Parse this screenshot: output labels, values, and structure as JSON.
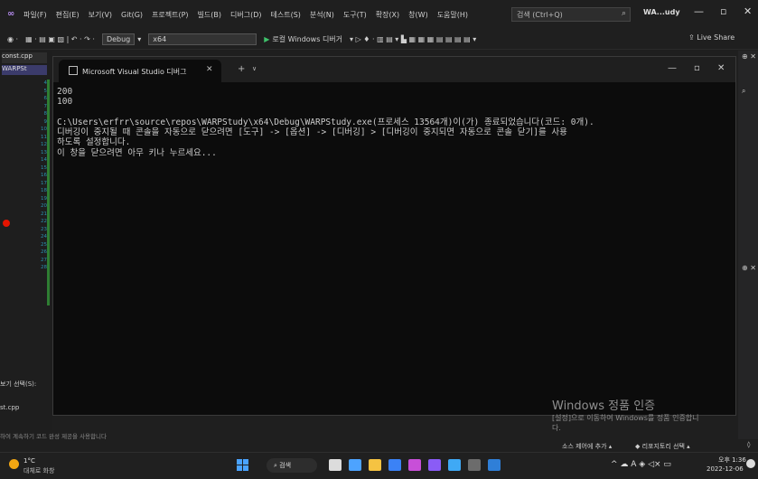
{
  "vs": {
    "menu": [
      "파일(F)",
      "편집(E)",
      "보기(V)",
      "Git(G)",
      "프로젝트(P)",
      "빌드(B)",
      "디버그(D)",
      "테스트(S)",
      "분석(N)",
      "도구(T)",
      "확장(X)",
      "창(W)",
      "도움말(H)"
    ],
    "search_placeholder": "검색 (Ctrl+Q)",
    "solution_name": "WA...udy",
    "toolbar": {
      "config": "Debug",
      "platform": "x64",
      "run_label": "로컬 Windows 디버거",
      "live_share": "Live Share"
    },
    "file_tab": "const.cpp",
    "project_tab": "WARPSt",
    "line_numbers": [
      "4",
      "5",
      "6",
      "7",
      "8",
      "9",
      "10",
      "11",
      "12",
      "13",
      "14",
      "15",
      "16",
      "17",
      "18",
      "19",
      "20",
      "21",
      "22",
      "23",
      "24",
      "25",
      "26",
      "27",
      "28"
    ],
    "bottom_left": [
      "보기 선택(S):",
      "st.cpp",
      "하여 계속하기 코드 완성 제공을 사용합니다"
    ],
    "status_right": [
      "소스 제어에 추가",
      "리포지토리 선택"
    ]
  },
  "console": {
    "tab_title": "Microsoft Visual Studio 디버그",
    "lines": [
      "200",
      "100",
      "",
      "C:\\Users\\erfrr\\source\\repos\\WARPStudy\\x64\\Debug\\WARPStudy.exe(프로세스 13564개)이(가) 종료되었습니다(코드: 0개).",
      "디버깅이 중지될 때 콘솔을 자동으로 닫으려면 [도구] -> [옵션] -> [디버깅] > [디버깅이 중지되면 자동으로 콘솔 닫기]를 사용",
      "하도록 설정합니다.",
      "이 창을 닫으려면 아무 키나 누르세요..."
    ]
  },
  "watermark": {
    "title": "Windows 정품 인증",
    "line1": "[설정]으로 이동하여 Windows를 정품 인증합니",
    "line2": "다."
  },
  "taskbar": {
    "weather_temp": "1°C",
    "weather_desc": "대체로 화창",
    "search_label": "검색",
    "time": "오후 1:36",
    "date": "2022-12-06"
  },
  "colors": {
    "console_bg": "#0c0c0c",
    "vs_bg": "#1f1f1f",
    "breakpoint": "#e51400",
    "accent_purple": "#b68cf0"
  }
}
